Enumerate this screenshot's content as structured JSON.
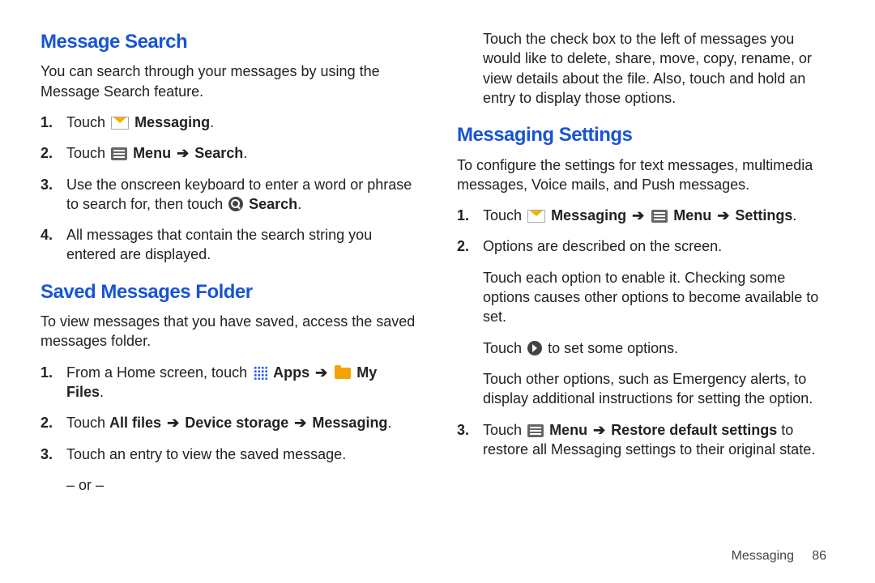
{
  "footer": {
    "chapter": "Messaging",
    "page": "86"
  },
  "arrow": "➔",
  "left": {
    "search": {
      "heading": "Message Search",
      "intro": "You can search through your messages by using the Message Search feature.",
      "s1_touch": "Touch ",
      "s1_messaging": "Messaging",
      "s1_period": ".",
      "s2_touch": "Touch ",
      "s2_menu": "Menu",
      "s2_search": "Search",
      "s2_period": ".",
      "s3_a": "Use the onscreen keyboard to enter a word or phrase to search for, then touch ",
      "s3_search": "Search",
      "s3_period": ".",
      "s4": "All messages that contain the search string you entered are displayed."
    },
    "saved": {
      "heading": "Saved Messages Folder",
      "intro": "To view messages that you have saved, access the saved messages folder.",
      "s1_a": "From a Home screen, touch ",
      "s1_apps": "Apps",
      "s1_my": "My Files",
      "s1_period": ".",
      "s2_touch": "Touch ",
      "s2_allfiles": "All files",
      "s2_device": "Device storage",
      "s2_messaging": "Messaging",
      "s2_period": ".",
      "s3": "Touch an entry to view the saved message.",
      "or": "– or –"
    }
  },
  "right": {
    "saved_cont": "Touch the check box to the left of messages you would like to delete, share, move, copy, rename, or view details about the file. Also, touch and hold an entry to display those options.",
    "settings": {
      "heading": "Messaging Settings",
      "intro": "To configure the settings for text messages, multimedia messages, Voice mails, and Push messages.",
      "s1_touch": "Touch ",
      "s1_messaging": "Messaging",
      "s1_menu": "Menu",
      "s1_settings": "Settings",
      "s1_period": ".",
      "s2": "Options are described on the screen.",
      "s2b": "Touch each option to enable it. Checking some options causes other options to become available to set.",
      "s2c_a": "Touch ",
      "s2c_b": " to set some options.",
      "s2d": "Touch other options, such as Emergency alerts, to display additional instructions for setting the option.",
      "s3_touch": "Touch ",
      "s3_menu": "Menu",
      "s3_restore": "Restore default settings",
      "s3_tail": " to restore all Messaging settings to their original state."
    }
  }
}
